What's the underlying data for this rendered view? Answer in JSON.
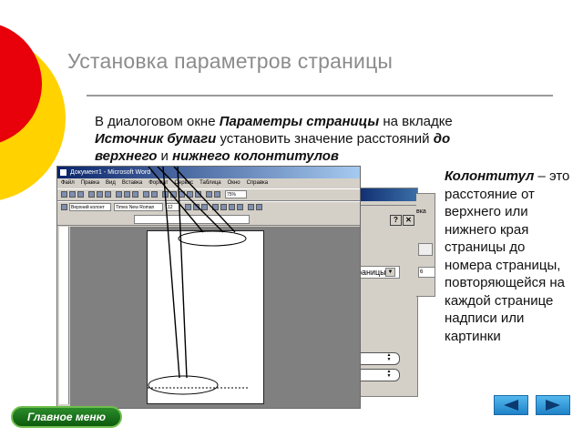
{
  "slide": {
    "title": "Установка параметров страницы",
    "instruction": {
      "p1": "В диалоговом окне ",
      "b1": "Параметры страницы",
      "p2": " на вкладке ",
      "b2": "Источник бумаги",
      "p3": " установить значение расстояний ",
      "b3": "до верхнего",
      "p4": " и ",
      "b4": "нижнего колонтитулов"
    },
    "definition": {
      "term": "Колонтитул",
      "text": " – это расстояние от верхнего или нижнего края страницы до номера страницы, повторяющейся на каждой странице надписи или картинки"
    },
    "colors": {
      "circle_red": "#e8000b",
      "circle_yellow": "#ffd200",
      "title": "#8c8c8c",
      "nav_blue": "#2b95d9",
      "menu_green": "#1a7a1a"
    }
  },
  "word_window": {
    "title": "Документ1 - Microsoft Word",
    "menu": [
      "Файл",
      "Правка",
      "Вид",
      "Вставка",
      "Формат",
      "Сервис",
      "Таблица",
      "Окно",
      "Справка"
    ],
    "style_combo": "Верхний колонт",
    "font_combo": "Times New Roman",
    "size_combo": "12",
    "zoom_combo": "75%"
  },
  "dialog": {
    "combo_value": "раницы",
    "tab_label": "вка",
    "spin_value": "6"
  },
  "nav": {
    "main_menu": "Главное меню",
    "prev_icon": "arrow-left-icon",
    "next_icon": "arrow-right-icon"
  }
}
